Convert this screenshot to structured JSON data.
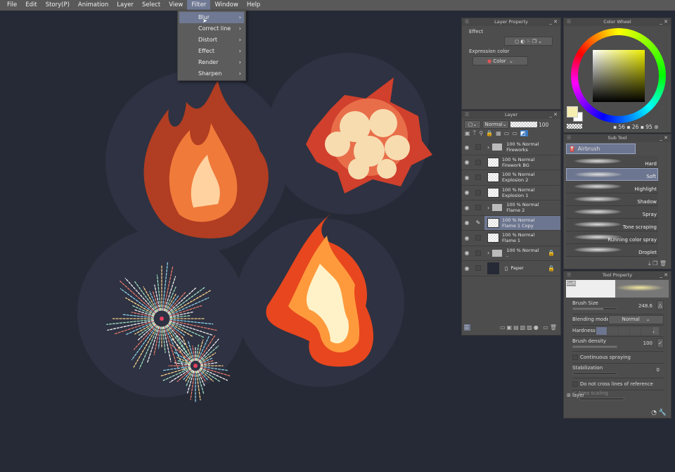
{
  "menu": [
    "File",
    "Edit",
    "Story(P)",
    "Animation",
    "Layer",
    "Select",
    "View",
    "Filter",
    "Window",
    "Help"
  ],
  "active_menu": "Filter",
  "filter_menu": [
    "Blur",
    "Correct line",
    "Distort",
    "Effect",
    "Render",
    "Sharpen"
  ],
  "layer_property": {
    "title": "Layer Property",
    "effect_label": "Effect",
    "expression_label": "Expression color",
    "expression_value": "Color"
  },
  "layer_panel": {
    "title": "Layer",
    "blend": "Normal",
    "opacity": "100",
    "layers": [
      {
        "top": "100 % Normal",
        "name": "Fireworks",
        "folder": true
      },
      {
        "top": "100 % Normal",
        "name": "Firework BG"
      },
      {
        "top": "100 % Normal",
        "name": "Explosion 2"
      },
      {
        "top": "100 % Normal",
        "name": "Explosion 1"
      },
      {
        "top": "100 % Normal",
        "name": "Flame 2",
        "folder": true
      },
      {
        "top": "100 % Normal",
        "name": "Flame 1 Copy",
        "selected": true
      },
      {
        "top": "100 % Normal",
        "name": "Flame 1"
      },
      {
        "top": "100 % Normal",
        "name": "-",
        "folder": true,
        "locked": true
      },
      {
        "top": "",
        "name": "Paper",
        "locked": true
      }
    ]
  },
  "color_wheel": {
    "title": "Color Wheel",
    "h": "56",
    "s": "26",
    "v": "95",
    "main_color": "#f5eeb0"
  },
  "sub_tool": {
    "title": "Sub Tool",
    "group": "Airbrush",
    "items": [
      "Hard",
      "Soft",
      "Highlight",
      "Shadow",
      "Spray",
      "Tone scraping",
      "Running color spray",
      "Droplet"
    ],
    "selected": "Soft"
  },
  "tool_property": {
    "title": "Tool Property",
    "preview": "Soft",
    "brush_size_label": "Brush Size",
    "brush_size": "248.6",
    "brush_size_fraction": 0.7,
    "blending_label": "Blending mode",
    "blending": "Normal",
    "hardness_label": "Hardness",
    "density_label": "Brush density",
    "density": "100",
    "continuous": "Continuous spraying",
    "stabilization_label": "Stabilization",
    "stabilization": "0",
    "no_cross": "Do not cross lines of reference layer",
    "area_scaling": "Area scaling"
  }
}
